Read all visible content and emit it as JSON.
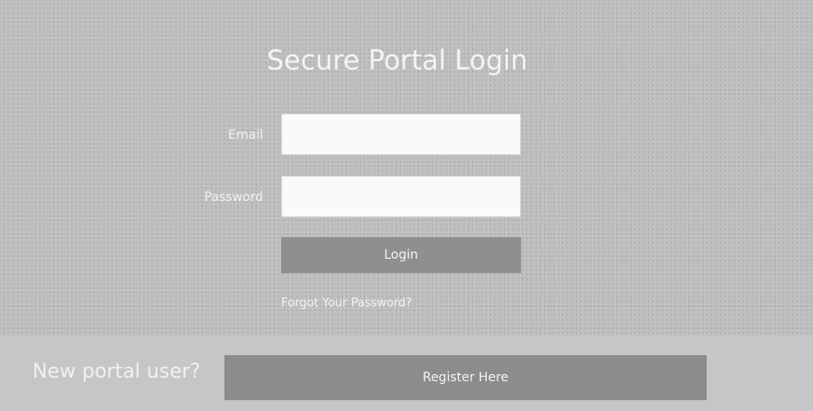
{
  "login": {
    "title": "Secure Portal Login",
    "email_label": "Email",
    "email_value": "",
    "password_label": "Password",
    "password_value": "",
    "login_label": "Login",
    "forgot_label": "Forgot Your Password?"
  },
  "register": {
    "prompt": "New portal user?",
    "button_label": "Register Here"
  },
  "colors": {
    "panel_bg": "#bdbdbd",
    "button_bg": "#8f8f8f",
    "input_bg": "#fafafa",
    "text_light": "#f4f4f4"
  }
}
